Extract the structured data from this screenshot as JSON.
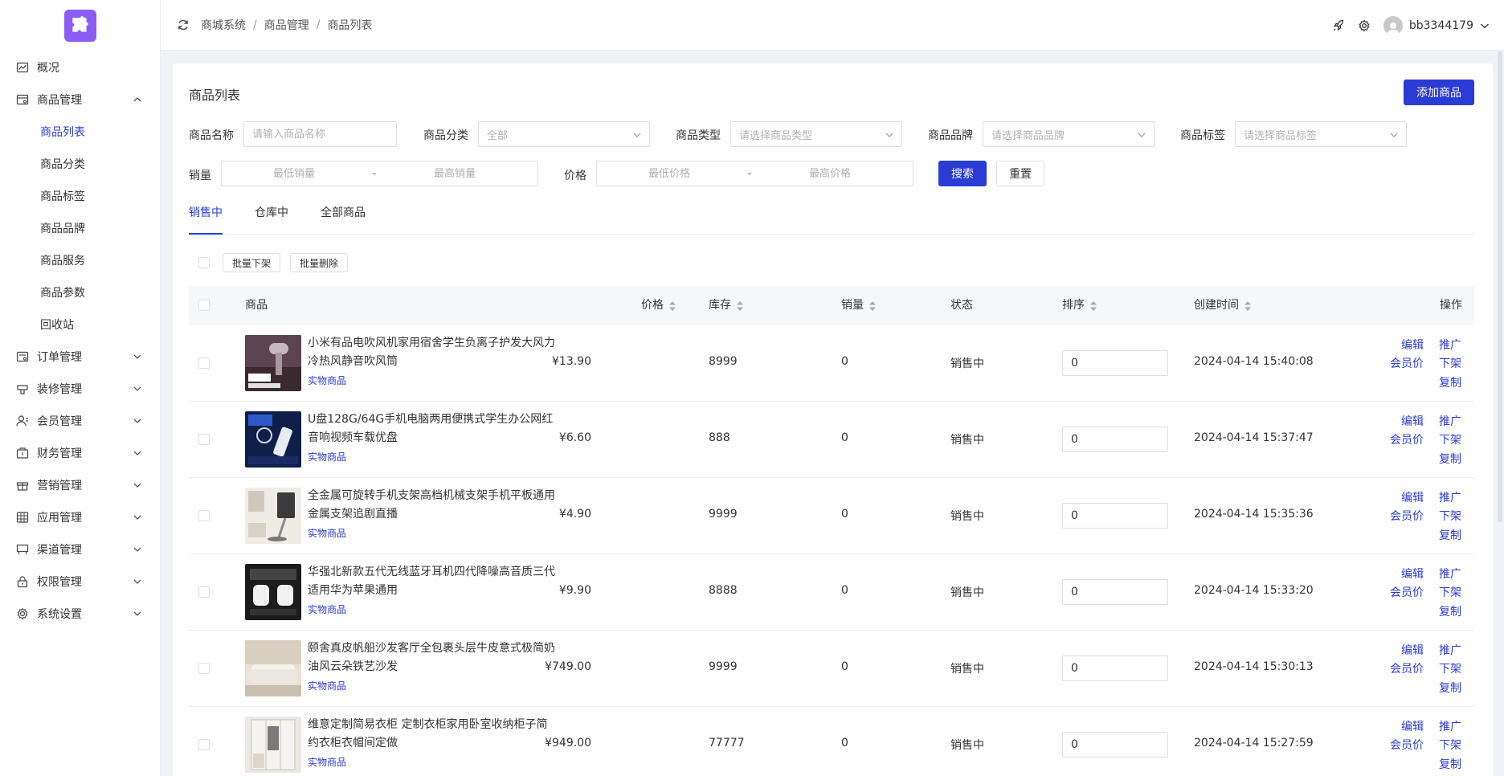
{
  "sidebar": {
    "items": [
      {
        "label": "概况",
        "icon": "chart-line-icon"
      },
      {
        "label": "商品管理",
        "icon": "goods-icon",
        "expanded": true
      },
      {
        "label": "订单管理",
        "icon": "order-icon"
      },
      {
        "label": "装修管理",
        "icon": "decoration-icon"
      },
      {
        "label": "会员管理",
        "icon": "member-icon"
      },
      {
        "label": "财务管理",
        "icon": "finance-icon"
      },
      {
        "label": "营销管理",
        "icon": "gift-icon"
      },
      {
        "label": "应用管理",
        "icon": "apps-grid-icon"
      },
      {
        "label": "渠道管理",
        "icon": "channel-icon"
      },
      {
        "label": "权限管理",
        "icon": "lock-icon"
      },
      {
        "label": "系统设置",
        "icon": "gear-icon"
      }
    ],
    "sub_items": [
      "商品列表",
      "商品分类",
      "商品标签",
      "商品品牌",
      "商品服务",
      "商品参数",
      "回收站"
    ]
  },
  "header": {
    "breadcrumb": [
      "商城系统",
      "商品管理",
      "商品列表"
    ],
    "username": "bb3344179"
  },
  "page": {
    "title": "商品列表",
    "add_button": "添加商品"
  },
  "filters": {
    "name_label": "商品名称",
    "name_placeholder": "请输入商品名称",
    "category_label": "商品分类",
    "category_value": "全部",
    "type_label": "商品类型",
    "type_placeholder": "请选择商品类型",
    "brand_label": "商品品牌",
    "brand_placeholder": "请选择商品品牌",
    "tag_label": "商品标签",
    "tag_placeholder": "请选择商品标签",
    "sales_label": "销量",
    "sales_min_placeholder": "最低销量",
    "sales_max_placeholder": "最高销量",
    "price_label": "价格",
    "price_min_placeholder": "最低价格",
    "price_max_placeholder": "最高价格",
    "range_dash": "-",
    "search_button": "搜索",
    "reset_button": "重置"
  },
  "tabs": [
    "销售中",
    "仓库中",
    "全部商品"
  ],
  "batch": {
    "offshelf_button": "批量下架",
    "delete_button": "批量删除"
  },
  "table": {
    "headers": {
      "product": "商品",
      "price": "价格",
      "stock": "库存",
      "sales": "销量",
      "status": "状态",
      "sort": "排序",
      "created": "创建时间",
      "actions": "操作"
    },
    "rows": [
      {
        "name": "小米有品电吹风机家用宿舍学生负离子护发大风力冷热风静音吹风筒",
        "type": "实物商品",
        "price": "¥13.90",
        "stock": "8999",
        "sales": "0",
        "status": "销售中",
        "sort": "0",
        "created": "2024-04-14 15:40:08"
      },
      {
        "name": "U盘128G/64G手机电脑两用便携式学生办公网红音响视频车载优盘",
        "type": "实物商品",
        "price": "¥6.60",
        "stock": "888",
        "sales": "0",
        "status": "销售中",
        "sort": "0",
        "created": "2024-04-14 15:37:47"
      },
      {
        "name": "全金属可旋转手机支架高档机械支架手机平板通用金属支架追剧直播",
        "type": "实物商品",
        "price": "¥4.90",
        "stock": "9999",
        "sales": "0",
        "status": "销售中",
        "sort": "0",
        "created": "2024-04-14 15:35:36"
      },
      {
        "name": "华强北新款五代无线蓝牙耳机四代降噪高音质三代适用华为苹果通用",
        "type": "实物商品",
        "price": "¥9.90",
        "stock": "8888",
        "sales": "0",
        "status": "销售中",
        "sort": "0",
        "created": "2024-04-14 15:33:20"
      },
      {
        "name": "颐舍真皮帆船沙发客厅全包裹头层牛皮意式极简奶油风云朵铁艺沙发",
        "type": "实物商品",
        "price": "¥749.00",
        "stock": "9999",
        "sales": "0",
        "status": "销售中",
        "sort": "0",
        "created": "2024-04-14 15:30:13"
      },
      {
        "name": "维意定制简易衣柜 定制衣柜家用卧室收纳柜子简约衣柜衣帽间定做",
        "type": "实物商品",
        "price": "¥949.00",
        "stock": "77777",
        "sales": "0",
        "status": "销售中",
        "sort": "0",
        "created": "2024-04-14 15:27:59"
      }
    ],
    "actions": {
      "edit": "编辑",
      "promote": "推广",
      "member_price": "会员价",
      "offshelf": "下架",
      "copy": "复制"
    }
  },
  "colors": {
    "primary": "#2a3bd6",
    "logo": "#8b5cf6"
  }
}
